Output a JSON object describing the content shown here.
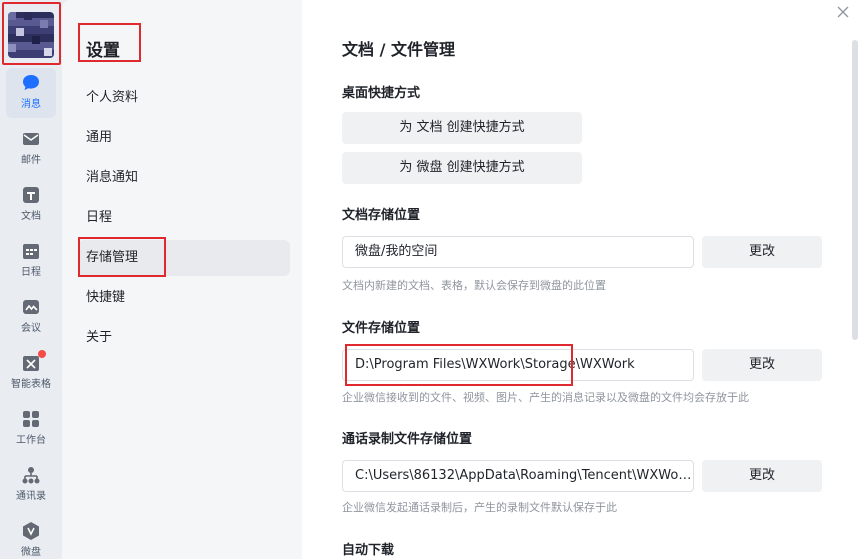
{
  "rail": {
    "items": [
      {
        "label": "消息",
        "icon": "chat-bubble-icon",
        "active": true
      },
      {
        "label": "邮件",
        "icon": "mail-icon"
      },
      {
        "label": "文档",
        "icon": "doc-icon"
      },
      {
        "label": "日程",
        "icon": "calendar-icon"
      },
      {
        "label": "会议",
        "icon": "meeting-icon"
      },
      {
        "label": "智能表格",
        "icon": "smart-sheet-icon",
        "badge": true
      },
      {
        "label": "工作台",
        "icon": "workbench-icon"
      },
      {
        "label": "通讯录",
        "icon": "contacts-icon"
      },
      {
        "label": "微盘",
        "icon": "drive-icon"
      }
    ]
  },
  "settings": {
    "title": "设置",
    "menu": [
      {
        "label": "个人资料"
      },
      {
        "label": "通用"
      },
      {
        "label": "消息通知"
      },
      {
        "label": "日程"
      },
      {
        "label": "存储管理",
        "active": true
      },
      {
        "label": "快捷键"
      },
      {
        "label": "关于"
      }
    ]
  },
  "main": {
    "title": "文档 / 文件管理",
    "desktop_shortcut": {
      "title": "桌面快捷方式",
      "btn_doc": "为 文档 创建快捷方式",
      "btn_drive": "为 微盘 创建快捷方式"
    },
    "doc_storage": {
      "title": "文档存储位置",
      "value": "微盘/我的空间",
      "change": "更改",
      "hint": "文档内新建的文档、表格，默认会保存到微盘的此位置"
    },
    "file_storage": {
      "title": "文件存储位置",
      "value": "D:\\Program Files\\WXWork\\Storage\\WXWork",
      "change": "更改",
      "hint": "企业微信接收到的文件、视频、图片、产生的消息记录以及微盘的文件均会存放于此"
    },
    "call_storage": {
      "title": "通话录制文件存储位置",
      "value": "C:\\Users\\86132\\AppData\\Roaming\\Tencent\\WXWork...",
      "change": "更改",
      "hint": "企业微信发起通话录制后，产生的录制文件默认保存于此"
    },
    "auto_download": {
      "title": "自动下载"
    }
  },
  "colors": {
    "accent": "#1e6fff",
    "highlight_frame": "#e0292e"
  }
}
